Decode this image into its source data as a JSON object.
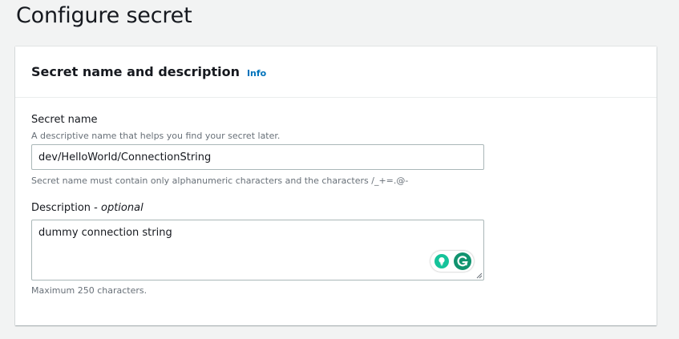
{
  "page": {
    "title": "Configure secret"
  },
  "section": {
    "title": "Secret name and description",
    "info_link": "Info"
  },
  "secret_name": {
    "label": "Secret name",
    "description": "A descriptive name that helps you find your secret later.",
    "value": "dev/HelloWorld/ConnectionString",
    "constraint": "Secret name must contain only alphanumeric characters and the characters /_+=.@-"
  },
  "description_field": {
    "label": "Description - ",
    "label_optional": "optional",
    "value": "dummy connection string",
    "constraint": "Maximum 250 characters."
  },
  "icons": {
    "suggestion": "lightbulb-icon",
    "grammarly": "grammarly-icon"
  },
  "colors": {
    "link": "#0073bb",
    "grammarly": "#15c39a",
    "grammarly_dark": "#11936f"
  }
}
